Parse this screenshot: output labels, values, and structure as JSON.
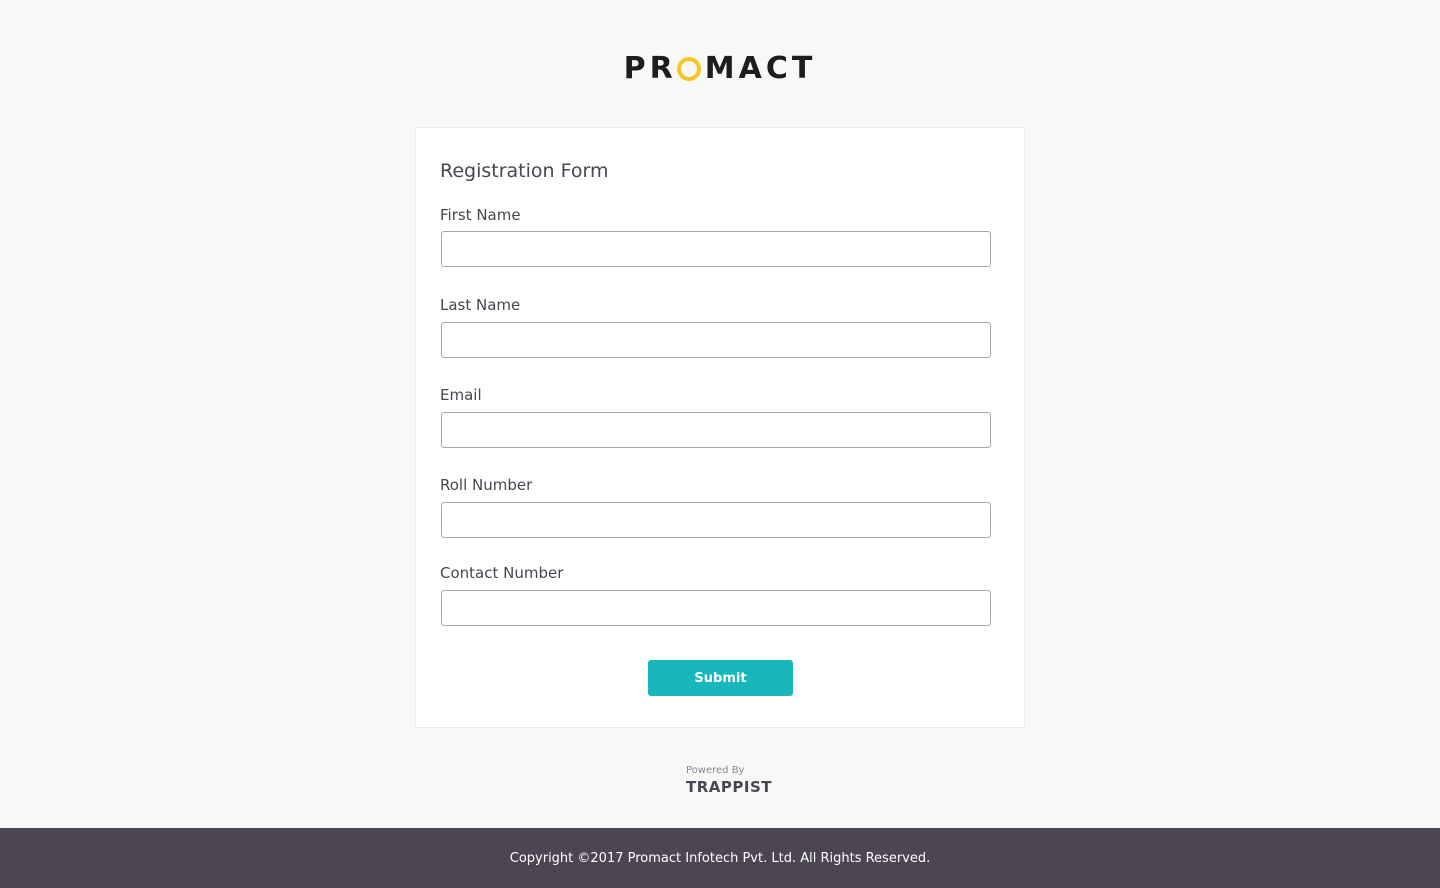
{
  "brand": {
    "logo_prefix": "PR",
    "logo_suffix": "MACT",
    "accent_color": "#f6c624"
  },
  "form": {
    "title": "Registration Form",
    "fields": [
      {
        "label": "First Name",
        "value": ""
      },
      {
        "label": "Last Name",
        "value": ""
      },
      {
        "label": "Email",
        "value": ""
      },
      {
        "label": "Roll Number",
        "value": ""
      },
      {
        "label": "Contact Number",
        "value": ""
      }
    ],
    "submit_label": "Submit",
    "submit_color": "#17b7bb"
  },
  "powered": {
    "label": "Powered By",
    "brand": "TRAPPIST"
  },
  "footer": {
    "copyright": "Copyright ©2017 Promact Infotech Pvt. Ltd. All Rights Reserved."
  }
}
